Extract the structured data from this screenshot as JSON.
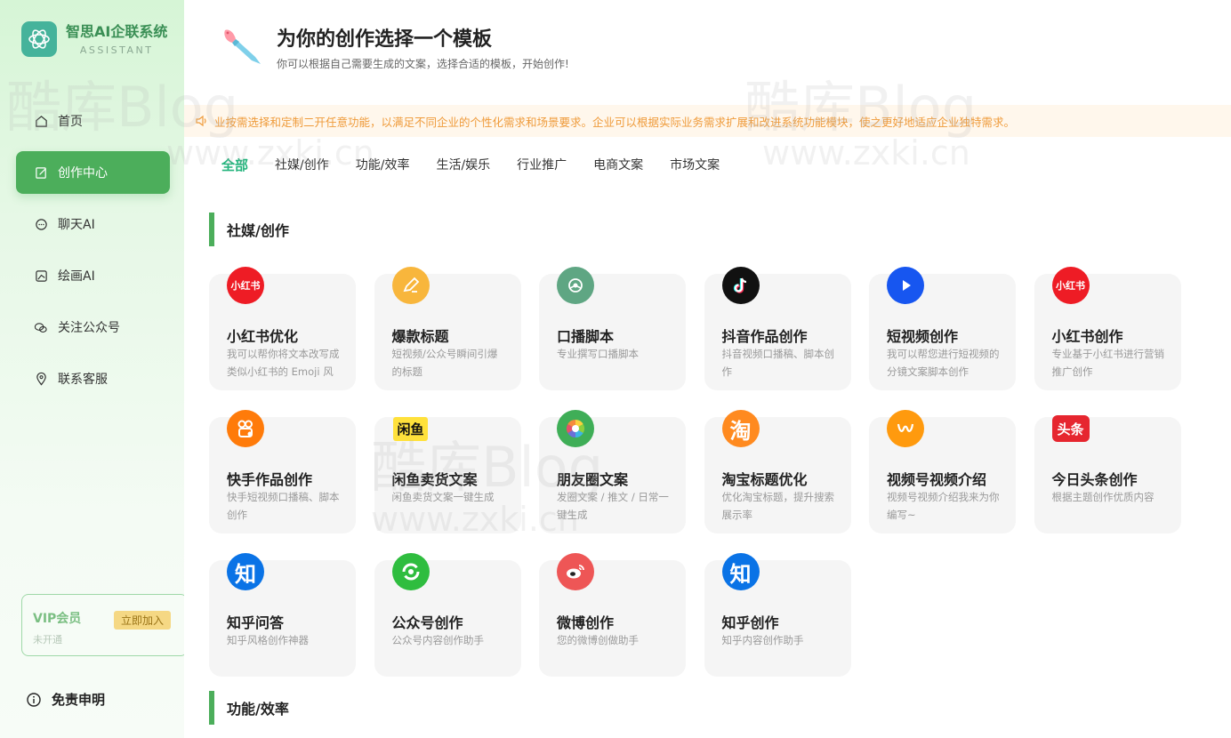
{
  "app": {
    "title": "智思AI企联系统",
    "subtitle": "ASSISTANT",
    "brand_color": "#45b39b",
    "accent": "#4cae5b"
  },
  "sidebar": {
    "items": [
      {
        "label": "首页",
        "icon": "home-icon",
        "active": false
      },
      {
        "label": "创作中心",
        "icon": "edit-icon",
        "active": true
      },
      {
        "label": "聊天AI",
        "icon": "chat-icon",
        "active": false
      },
      {
        "label": "绘画AI",
        "icon": "painting-icon",
        "active": false
      },
      {
        "label": "关注公众号",
        "icon": "wechat-icon",
        "active": false
      },
      {
        "label": "联系客服",
        "icon": "location-icon",
        "active": false
      }
    ],
    "vip": {
      "title": "VIP会员",
      "status": "未开通",
      "join_label": "立即加入"
    },
    "disclaimer": "免责申明"
  },
  "header": {
    "title": "为你的创作选择一个模板",
    "subtitle": "你可以根据自己需要生成的文案，选择合适的模板，开始创作!"
  },
  "notice": {
    "text": "业按需选择和定制二开任意功能，以满足不同企业的个性化需求和场景要求。企业可以根据实际业务需求扩展和改进系统功能模块，使之更好地适应企业独特需求。",
    "color": "#ef9b3b"
  },
  "tabs": [
    "全部",
    "社媒/创作",
    "功能/效率",
    "生活/娱乐",
    "行业推广",
    "电商文案",
    "市场文案"
  ],
  "sections": [
    {
      "title": "社媒/创作",
      "cards": [
        {
          "title": "小红书优化",
          "desc": "我可以帮你将文本改写成类似小红书的 Emoji 风格",
          "icon": "xiaohongshu-icon",
          "icon_text": "小红书",
          "color": "#ee1c25"
        },
        {
          "title": "爆款标题",
          "desc": "短视频/公众号瞬间引爆的标题",
          "icon": "pen-icon",
          "icon_text": "",
          "color": "#f8b63c"
        },
        {
          "title": "口播脚本",
          "desc": "专业撰写口播脚本",
          "icon": "broadcast-icon",
          "icon_text": "",
          "color": "#5fa683"
        },
        {
          "title": "抖音作品创作",
          "desc": "抖音视频口播稿、脚本创作",
          "icon": "douyin-icon",
          "icon_text": "",
          "color": "#111111"
        },
        {
          "title": "短视频创作",
          "desc": "我可以帮您进行短视频的分镜文案脚本创作",
          "icon": "play-icon",
          "icon_text": "",
          "color": "#1756f0"
        },
        {
          "title": "小红书创作",
          "desc": "专业基于小红书进行营销推广创作",
          "icon": "xiaohongshu-icon",
          "icon_text": "小红书",
          "color": "#ee1c25"
        },
        {
          "title": "快手作品创作",
          "desc": "快手短视频口播稿、脚本创作",
          "icon": "kuaishou-icon",
          "icon_text": "",
          "color": "#ff7b0a"
        },
        {
          "title": "闲鱼卖货文案",
          "desc": "闲鱼卖货文案一键生成",
          "icon": "xianyu-icon",
          "icon_text": "闲鱼",
          "color": "#ffe13b"
        },
        {
          "title": "朋友圈文案",
          "desc": "发圈文案 / 推文 / 日常一键生成",
          "icon": "moments-icon",
          "icon_text": "",
          "color": "#3fae57"
        },
        {
          "title": "淘宝标题优化",
          "desc": "优化淘宝标题，提升搜索展示率",
          "icon": "taobao-icon",
          "icon_text": "淘",
          "color": "#ff8a1f"
        },
        {
          "title": "视频号视频介绍",
          "desc": "视频号视频介绍我来为你编写~",
          "icon": "channels-icon",
          "icon_text": "",
          "color": "#ff9a0e"
        },
        {
          "title": "今日头条创作",
          "desc": "根据主题创作优质内容",
          "icon": "toutiao-icon",
          "icon_text": "头条",
          "color": "#e6262f"
        },
        {
          "title": "知乎问答",
          "desc": "知乎风格创作神器",
          "icon": "zhihu-icon",
          "icon_text": "知",
          "color": "#0a73e6"
        },
        {
          "title": "公众号创作",
          "desc": "公众号内容创作助手",
          "icon": "wechat-official-icon",
          "icon_text": "",
          "color": "#2fbd3f"
        },
        {
          "title": "微博创作",
          "desc": "您的微博创做助手",
          "icon": "weibo-icon",
          "icon_text": "",
          "color": "#ee5656"
        },
        {
          "title": "知乎创作",
          "desc": "知乎内容创作助手",
          "icon": "zhihu-icon",
          "icon_text": "知",
          "color": "#0a73e6"
        }
      ]
    },
    {
      "title": "功能/效率",
      "cards": []
    }
  ],
  "watermark": {
    "a": "酷库Blog",
    "b": "www.zxki.cn"
  }
}
